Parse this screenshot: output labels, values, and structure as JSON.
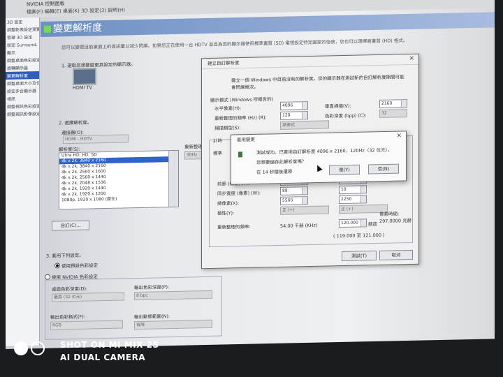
{
  "app": {
    "title": "NVIDIA 控制面板",
    "menu": "檔案(F)  編輯(E)  桌面(K)  3D 設定(3)  說明(H)"
  },
  "tree": [
    "3D 設定",
    "調整影像設定預覽",
    "管理 3D 設定",
    "設定 Surround、PhysX",
    "顯示",
    "調整桌面色彩設定",
    "旋轉顯示器",
    "變更解析度",
    "調整桌面大小及位置",
    "設定多台顯示器",
    "視訊",
    "調整視訊色彩設定",
    "調整視訊影像設定"
  ],
  "page": {
    "title": "變更解析度",
    "description": "您可以變更目前桌面上的資訊量以減少閃爍。如果您正在使用一台 HDTV 並且為您的顯示器使用標準畫質 (SD) 電視設定特定國家的信號，您也可以選擇高畫質 (HD) 格式。",
    "step1": "1. 選取您想要變更其設定的顯示器。",
    "monitor_name": "HDMI TV",
    "step2": "2. 選擇解析度。",
    "connector_label": "連接器(O):",
    "connector_value": "HDMI - HDTV",
    "resolution_label": "解析度(S):",
    "refresh_label": "重新整理頻率(R):",
    "refresh_value": "30Hz",
    "customize_button": "自訂(C)...",
    "step3": "3. 套用下列設定。",
    "radio_default": "使用預設色彩設定",
    "radio_nvidia": "使用 NVIDIA 色彩設定",
    "desktop_color_label": "桌面色彩深度(D):",
    "desktop_color_value": "最高 (32 位元)",
    "output_color_label": "輸出色彩深度(P):",
    "output_color_value": "8 bpc",
    "output_format_label": "輸出色彩格式(F):",
    "output_format_value": "RGB",
    "dynamic_range_label": "輸出動態範圍(N):",
    "dynamic_range_value": "有限"
  },
  "resolutions": {
    "header": "Ultra HD, HD, SD",
    "items": [
      "4k x 2k, 3840 x 2160",
      "4k x 2k, 3840 x 2160",
      "4k x 2k, 2560 x 1600",
      "4k x 2k, 2560 x 1440",
      "4k x 2k, 2048 x 1536",
      "4k x 2k, 1920 x 1440",
      "4k x 2k, 1920 x 1200",
      "1080p, 1920 x 1080 (原生)"
    ],
    "selected_index": 0
  },
  "custom_dialog": {
    "title": "建立自訂解析度",
    "intro": "建立一個 Windows 中目前沒有的解析度。您的顯示器在測試新的自訂解析度期間可能會閃爍幾次。",
    "display_mode_label": "顯示模式 (Windows 所報告的)",
    "h_pixels_label": "水平像素(H):",
    "h_pixels_value": "4096",
    "v_lines_label": "垂直掃描(V):",
    "v_lines_value": "2160",
    "refresh_label": "重新整理的頻率 (Hz) (R):",
    "refresh_value": "120",
    "color_depth_label": "色彩深度 (bpp) (C):",
    "color_depth_value": "32",
    "scan_type_label": "掃描類型(S):",
    "scan_type_value": "漸進式",
    "timing_label": "計時",
    "standard_label": "標準",
    "front_porch_label": "前廊 (像素) (F):",
    "front_porch_h": "1020",
    "front_porch_v": "8",
    "sync_width_label": "同步寬度 (像素) (W):",
    "sync_width_h": "88",
    "sync_width_v": "10",
    "total_pixels_label": "總像素(X):",
    "total_pixels_h": "5500",
    "total_pixels_v": "2250",
    "polarity_label": "極性(Y):",
    "polarity_h": "正 (+)",
    "polarity_v": "正 (+)",
    "refresh_rate_label": "重新整理的頻率:",
    "refresh_khz": "54.00 千赫 (KHz)",
    "refresh_hz_value": "120.000",
    "refresh_unit": "赫茲",
    "pixel_clock_label": "像素時間:",
    "pixel_clock_value": "297.0000 兆赫",
    "range": "( 119.000 至 121.000 )",
    "test_button": "測試(T)",
    "cancel_button": "取消"
  },
  "alert": {
    "title": "套用變更",
    "message": "測試成功。已套用自訂解析度 4096 x 2160，120Hz（32 位元）。",
    "question": "您想要儲存此解析度嗎？",
    "countdown": "在 14 秒鐘後還原",
    "yes_button": "是(Y)",
    "no_button": "否(N)"
  },
  "watermark": {
    "line1": "SHOT ON MI MIX 2S",
    "line2": "AI DUAL CAMERA"
  }
}
